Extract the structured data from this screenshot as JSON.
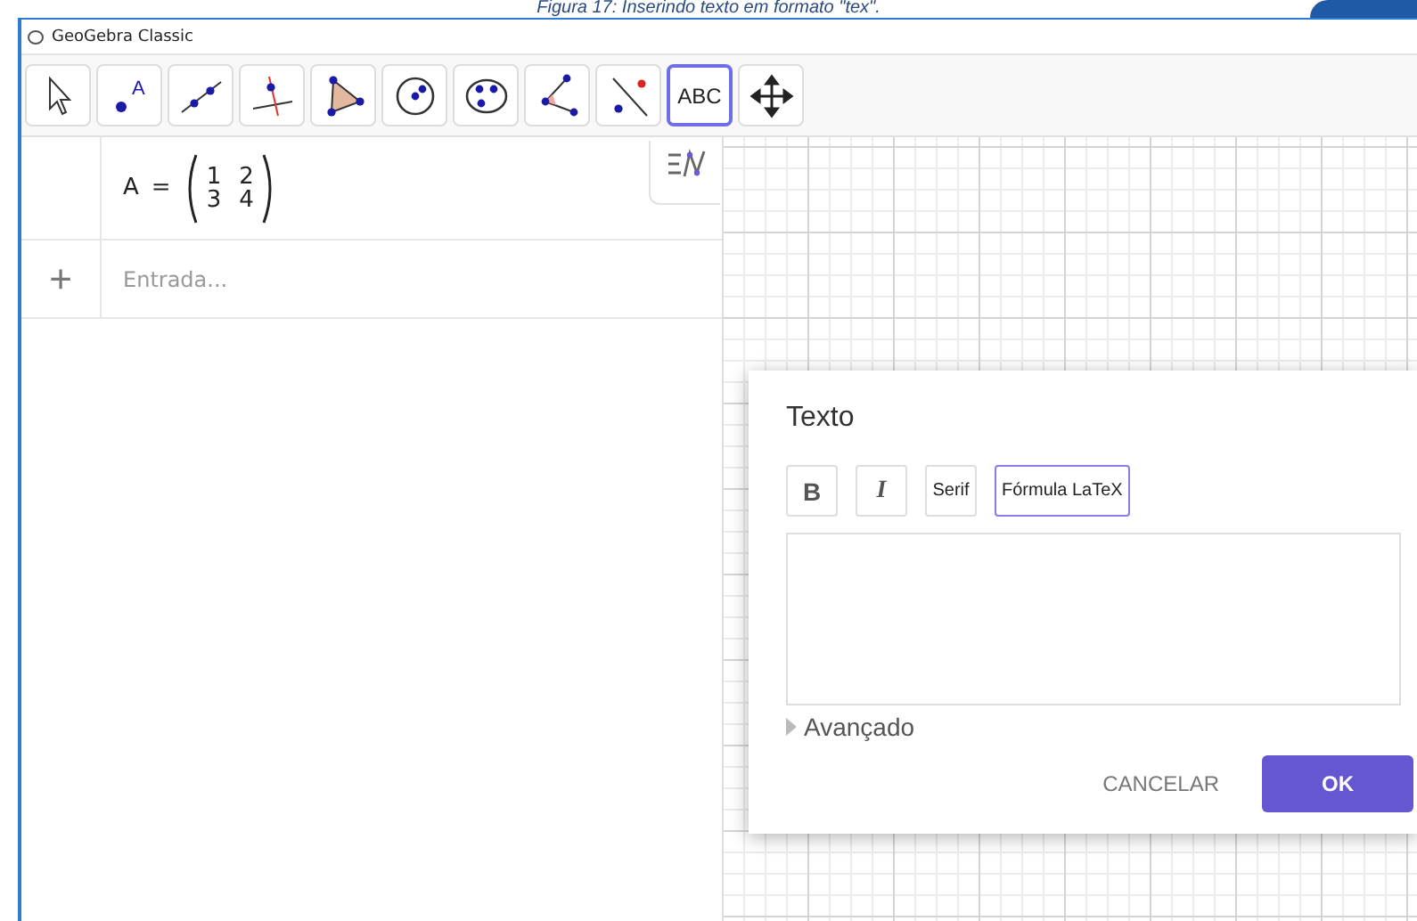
{
  "caption": "Figura 17: Inserindo texto em formato \"tex\".",
  "window": {
    "title": "GeoGebra Classic"
  },
  "tools": [
    {
      "kind": "move",
      "selected": false
    },
    {
      "kind": "point",
      "letter": "A",
      "selected": false
    },
    {
      "kind": "line",
      "selected": false
    },
    {
      "kind": "perpendicular",
      "selected": false
    },
    {
      "kind": "polygon",
      "selected": false
    },
    {
      "kind": "circle",
      "selected": false
    },
    {
      "kind": "conic",
      "selected": false
    },
    {
      "kind": "angle",
      "selected": false
    },
    {
      "kind": "reflect",
      "selected": false
    },
    {
      "kind": "text",
      "label": "ABC",
      "selected": true
    },
    {
      "kind": "move-view",
      "selected": false
    }
  ],
  "algebra": {
    "rows": [
      {
        "name": "A",
        "equals": "=",
        "matrix": [
          [
            "1",
            "2"
          ],
          [
            "3",
            "4"
          ]
        ]
      }
    ],
    "input": {
      "plus": "+",
      "placeholder": "Entrada..."
    }
  },
  "dialog": {
    "title": "Texto",
    "format_buttons": [
      {
        "label": "B",
        "kind": "bold",
        "selected": false
      },
      {
        "label": "I",
        "kind": "italic",
        "selected": false
      },
      {
        "label": "Serif",
        "kind": "plain",
        "selected": false
      },
      {
        "label": "Fórmula LaTeX",
        "kind": "plain",
        "selected": true
      }
    ],
    "advanced": "Avançado",
    "buttons": [
      {
        "label": "CANCELAR",
        "kind": "flat"
      },
      {
        "label": "OK",
        "kind": "primary"
      }
    ]
  }
}
